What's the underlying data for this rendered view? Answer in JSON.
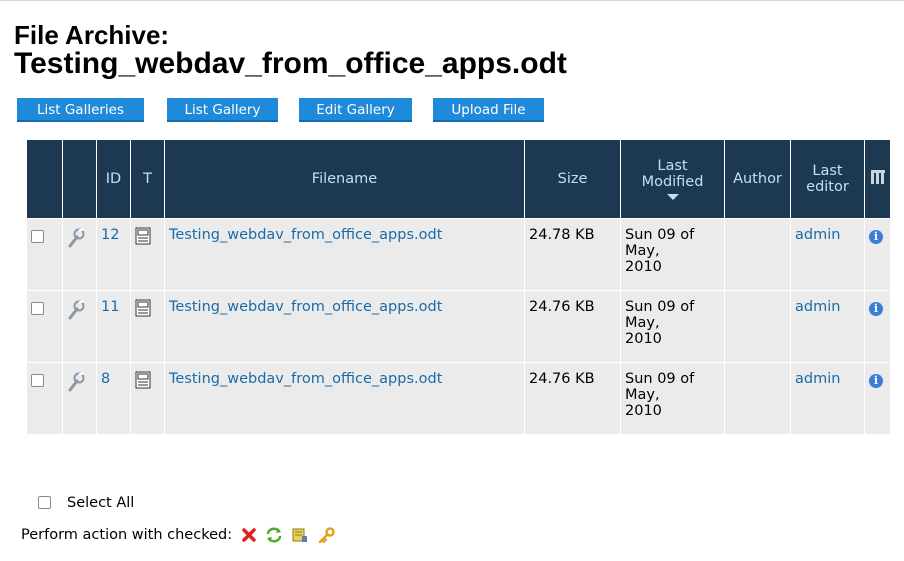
{
  "page": {
    "title_line1": "File Archive:",
    "title_line2": "Testing_webdav_from_office_apps.odt"
  },
  "buttons": {
    "list_galleries": "List Galleries",
    "list_gallery": "List Gallery",
    "edit_gallery": "Edit Gallery",
    "upload_file": "Upload File"
  },
  "table": {
    "headers": {
      "id": "ID",
      "type": "T",
      "filename": "Filename",
      "size": "Size",
      "last_modified_1": "Last",
      "last_modified_2": "Modified",
      "author": "Author",
      "last_editor_1": "Last",
      "last_editor_2": "editor"
    },
    "rows": [
      {
        "id": "12",
        "filename": "Testing_webdav_from_office_apps.odt",
        "size": "24.78 KB",
        "date1": "Sun 09 of",
        "date2": "May,",
        "date3": "2010",
        "author": "",
        "editor": "admin"
      },
      {
        "id": "11",
        "filename": "Testing_webdav_from_office_apps.odt",
        "size": "24.76 KB",
        "date1": "Sun 09 of",
        "date2": "May,",
        "date3": "2010",
        "author": "",
        "editor": "admin"
      },
      {
        "id": "8",
        "filename": "Testing_webdav_from_office_apps.odt",
        "size": "24.76 KB",
        "date1": "Sun 09 of",
        "date2": "May,",
        "date3": "2010",
        "author": "",
        "editor": "admin"
      }
    ]
  },
  "footer": {
    "select_all": "Select All",
    "perform_action": "Perform action with checked:"
  },
  "colors": {
    "header_bg": "#1c3951",
    "header_text": "#bfe0f4",
    "button_bg": "#1f8ad9",
    "link": "#1a6ca8",
    "row_bg": "#ebebeb"
  },
  "icons": [
    "wrench-icon",
    "document-icon",
    "info-icon",
    "columns-icon",
    "delete-icon",
    "move-icon",
    "assign-icon",
    "permissions-key-icon"
  ]
}
